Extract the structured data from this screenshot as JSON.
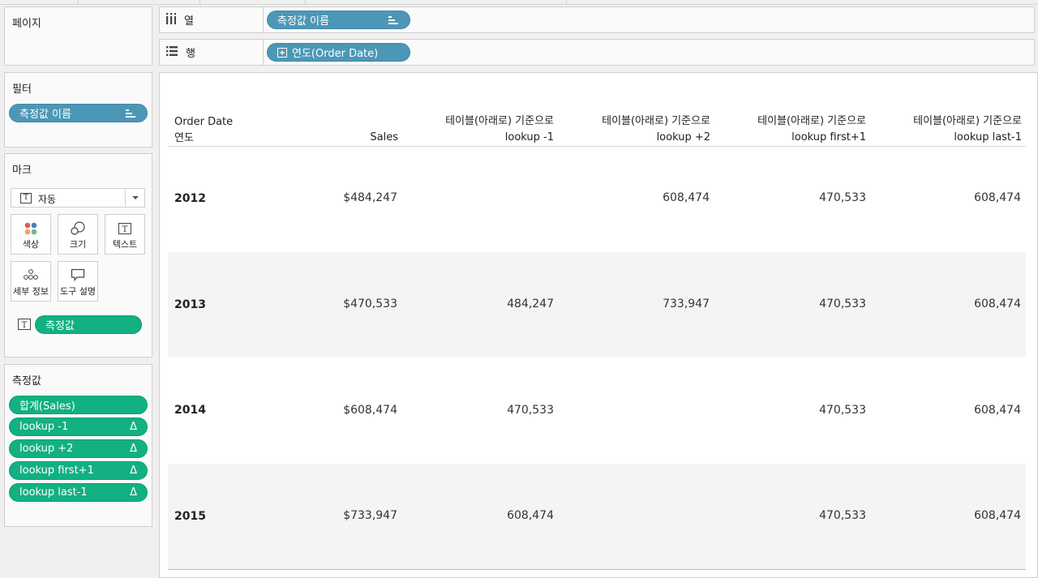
{
  "pages": {
    "title": "페이지"
  },
  "shelves": {
    "columns": {
      "label": "열",
      "pill": "측정값 이름"
    },
    "rows": {
      "label": "행",
      "pill": "연도(Order Date)"
    }
  },
  "filters": {
    "title": "필터",
    "pill": "측정값 이름"
  },
  "marks": {
    "title": "마크",
    "type_select": "자동",
    "buttons": {
      "color": "색상",
      "size": "크기",
      "text": "텍스트",
      "detail": "세부 정보",
      "tooltip": "도구 설명"
    },
    "text_pill": "측정값"
  },
  "measure_values": {
    "title": "측정값",
    "items": [
      {
        "label": "합계(Sales)",
        "delta": ""
      },
      {
        "label": "lookup -1",
        "delta": "Δ"
      },
      {
        "label": "lookup +2",
        "delta": "Δ"
      },
      {
        "label": "lookup first+1",
        "delta": "Δ"
      },
      {
        "label": "lookup last-1",
        "delta": "Δ"
      }
    ]
  },
  "table": {
    "row_header": {
      "line1": "Order Date",
      "line2": "연도"
    },
    "columns": [
      {
        "line1": "",
        "line2": "Sales"
      },
      {
        "line1": "테이블(아래로) 기준으로",
        "line2": "lookup -1"
      },
      {
        "line1": "테이블(아래로) 기준으로",
        "line2": "lookup +2"
      },
      {
        "line1": "테이블(아래로) 기준으로",
        "line2": "lookup first+1"
      },
      {
        "line1": "테이블(아래로) 기준으로",
        "line2": "lookup last-1"
      }
    ],
    "rows": [
      {
        "year": "2012",
        "values": [
          "$484,247",
          "",
          "608,474",
          "470,533",
          "608,474"
        ]
      },
      {
        "year": "2013",
        "values": [
          "$470,533",
          "484,247",
          "733,947",
          "470,533",
          "608,474"
        ]
      },
      {
        "year": "2014",
        "values": [
          "$608,474",
          "470,533",
          "",
          "470,533",
          "608,474"
        ]
      },
      {
        "year": "2015",
        "values": [
          "$733,947",
          "608,474",
          "",
          "470,533",
          "608,474"
        ]
      }
    ]
  },
  "colors": {
    "blue_pill": "#4d97b6",
    "green_pill": "#12b082",
    "band": "#f4f4f4"
  },
  "icons": {
    "columns": "columns-icon",
    "rows": "rows-icon",
    "sort": "sort-descending-icon",
    "expand": "expand-plus-icon",
    "text": "text-mark-icon",
    "color": "color-dots-icon",
    "size": "size-circles-icon",
    "detail": "detail-dots-icon",
    "tooltip": "tooltip-icon",
    "delta": "delta-icon",
    "dropdown": "dropdown-caret-icon"
  }
}
